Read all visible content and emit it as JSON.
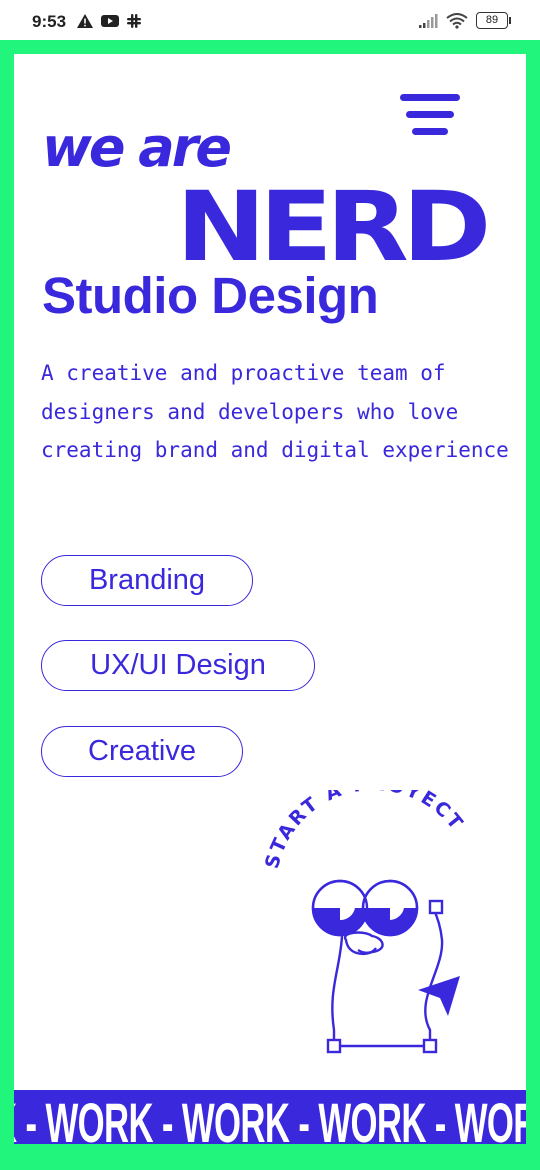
{
  "status_bar": {
    "time": "9:53",
    "left_icons": [
      "warning-icon",
      "youtube-icon",
      "slack-icon"
    ],
    "right_icons": [
      "signal-icon",
      "wifi-icon"
    ],
    "battery": "89"
  },
  "colors": {
    "accent": "#3a28dc",
    "frame": "#22f57c",
    "background": "#ffffff"
  },
  "hero": {
    "line1": "we are",
    "line2": "NERD",
    "line3": "Studio Design",
    "description": "A creative and proactive team of designers and developers who love creating brand and digital experience"
  },
  "services": [
    "Branding",
    "UX/UI Design",
    "Creative"
  ],
  "cta": {
    "curved_text": "START A PROYECT"
  },
  "ticker": {
    "text": "K - WORK - WORK - WORK - WORK - WORK -"
  }
}
